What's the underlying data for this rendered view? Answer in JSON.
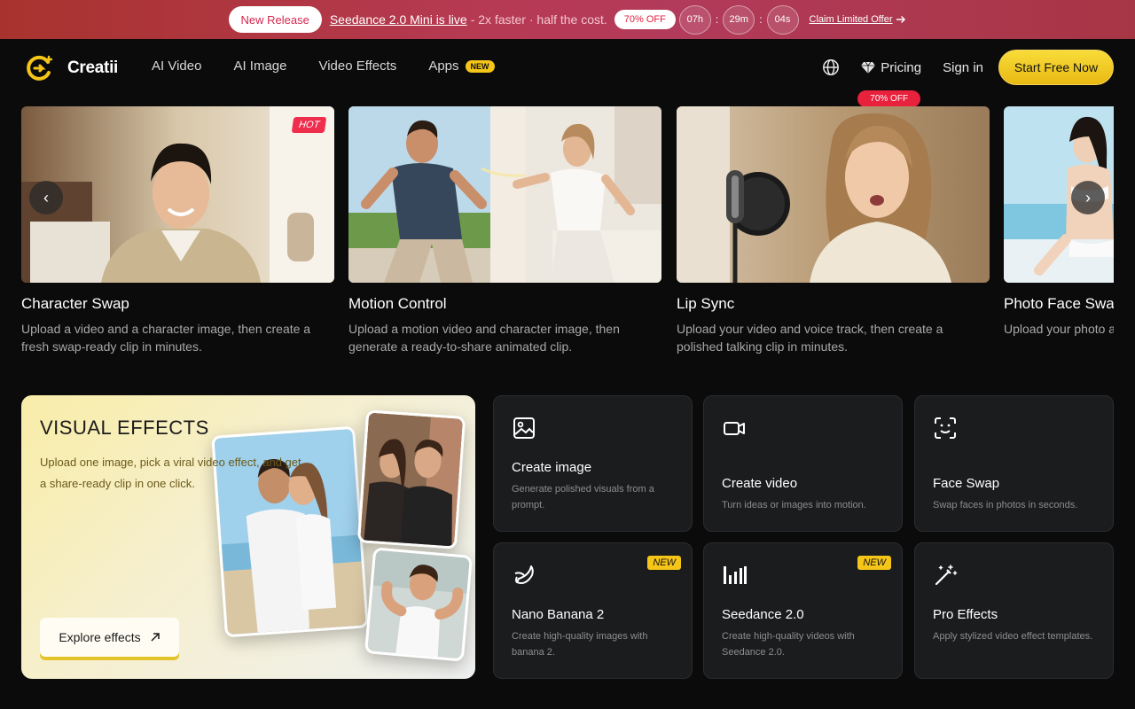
{
  "promo": {
    "badge": "New Release",
    "headline": "Seedance 2.0 Mini is live",
    "sub": "- 2x faster · half the cost.",
    "discount": "70% OFF",
    "timer": {
      "hours": "07h",
      "minutes": "29m",
      "seconds": "04s",
      "sep": ":"
    },
    "claim": "Claim Limited Offer"
  },
  "nav": {
    "brand": "Creatii",
    "links": [
      "AI Video",
      "AI Image",
      "Video Effects",
      "Apps"
    ],
    "apps_badge": "NEW",
    "pricing": "Pricing",
    "pricing_badge": "70% OFF",
    "signin": "Sign in",
    "cta": "Start Free Now"
  },
  "carousel": {
    "items": [
      {
        "title": "Character Swap",
        "desc": "Upload a video and a character image, then create a fresh swap-ready clip in minutes.",
        "badge": "HOT"
      },
      {
        "title": "Motion Control",
        "desc": "Upload a motion video and character image, then generate a ready-to-share animated clip."
      },
      {
        "title": "Lip Sync",
        "desc": "Upload your video and voice track, then create a polished talking clip in minutes."
      },
      {
        "title": "Photo Face Swap",
        "desc": "Upload your photo a swap ready to share"
      }
    ],
    "prev": "‹",
    "next": "›"
  },
  "vfx": {
    "title": "VISUAL EFFECTS",
    "desc": "Upload one image, pick a viral video effect, and get a share-ready clip in one click.",
    "cta": "Explore effects"
  },
  "tools": [
    {
      "title": "Create image",
      "desc": "Generate polished visuals from a prompt.",
      "icon": "image-icon"
    },
    {
      "title": "Create video",
      "desc": "Turn ideas or images into motion.",
      "icon": "video-camera-icon"
    },
    {
      "title": "Face Swap",
      "desc": "Swap faces in photos in seconds.",
      "icon": "face-scan-icon"
    },
    {
      "title": "Nano Banana 2",
      "desc": "Create high-quality images with banana 2.",
      "badge": "NEW",
      "icon": "banana-icon"
    },
    {
      "title": "Seedance 2.0",
      "desc": "Create high-quality videos with Seedance 2.0.",
      "badge": "NEW",
      "icon": "audio-bars-icon"
    },
    {
      "title": "Pro Effects",
      "desc": "Apply stylized video effect templates.",
      "icon": "magic-wand-icon"
    }
  ],
  "colors": {
    "accent": "#f5c518",
    "hot": "#ef2d4d",
    "banner": "#b23a55"
  }
}
